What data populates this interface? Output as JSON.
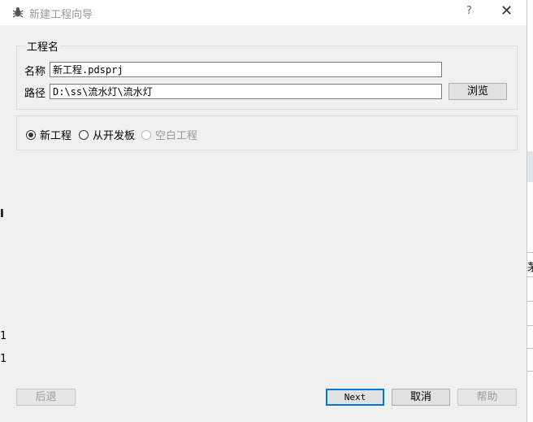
{
  "window": {
    "title": "新建工程向导",
    "help": "?",
    "close": "✕"
  },
  "project_group": {
    "title": "工程名",
    "name_label": "名称",
    "name_value": "新工程.pdsprj",
    "path_label": "路径",
    "path_value": "D:\\ss\\流水灯\\流水灯",
    "browse_label": "浏览"
  },
  "options": {
    "new_project": "新工程",
    "from_board": "从开发板",
    "blank_project": "空白工程",
    "selected": "new_project"
  },
  "footer": {
    "back": "后退",
    "next": "Next",
    "cancel": "取消",
    "help": "帮助"
  },
  "background": {
    "edge_chars": [
      "I",
      "1",
      "1",
      "茅"
    ]
  }
}
